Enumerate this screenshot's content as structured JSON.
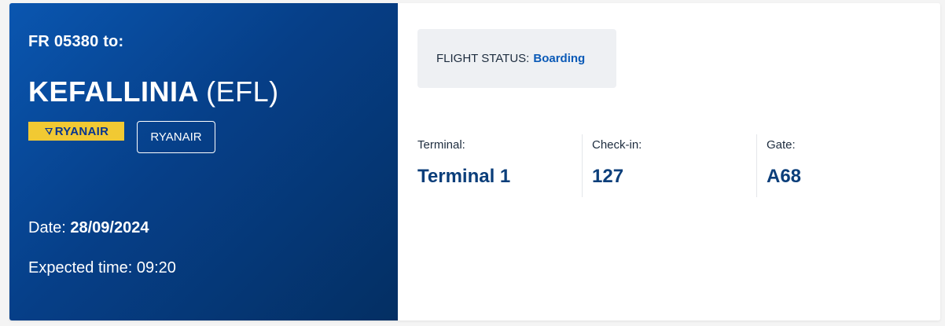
{
  "flight": {
    "number_line": "FR 05380 to:",
    "destination_name": "KEFALLINIA",
    "destination_code": "(EFL)",
    "logo_text": "RYANAIR",
    "carrier_button": "RYANAIR",
    "date_label": "Date:",
    "date_value": "28/09/2024",
    "time_label": "Expected time:",
    "time_value": "09:20"
  },
  "status": {
    "label": "FLIGHT STATUS:",
    "value": "Boarding"
  },
  "details": {
    "terminal_label": "Terminal:",
    "terminal_value": "Terminal 1",
    "checkin_label": "Check-in:",
    "checkin_value": "127",
    "gate_label": "Gate:",
    "gate_value": "A68"
  },
  "colors": {
    "panel_gradient_start": "#0a56b0",
    "panel_gradient_end": "#042f63",
    "logo_yellow": "#f1c933",
    "status_accent": "#0b5ab7",
    "value_color": "#0b3e7a"
  }
}
